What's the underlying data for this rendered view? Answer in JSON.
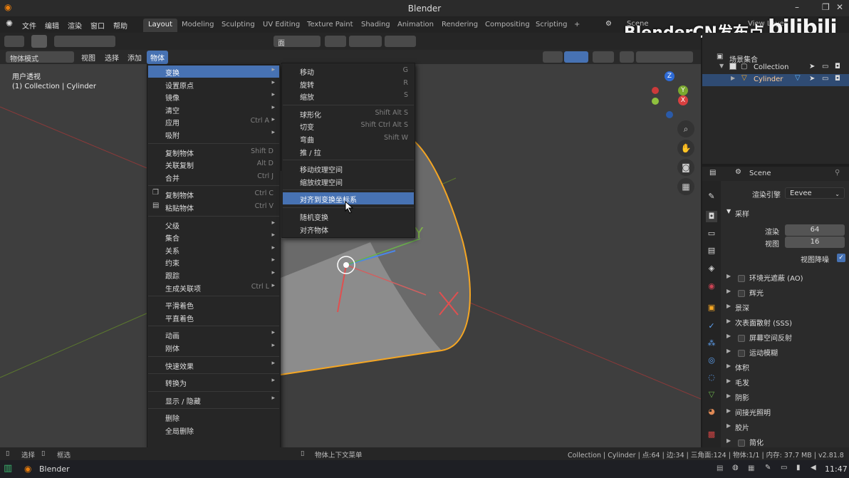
{
  "window": {
    "title": "Blender",
    "minimize": "–",
    "restore": "❐",
    "close": "✕"
  },
  "menubar": {
    "items": [
      "文件",
      "编辑",
      "渲染",
      "窗口",
      "帮助"
    ],
    "workspaces": [
      "Layout",
      "Modeling",
      "Sculpting",
      "UV Editing",
      "Texture Paint",
      "Shading",
      "Animation",
      "Rendering",
      "Compositing",
      "Scripting"
    ],
    "add_tab": "+",
    "scene": "Scene",
    "view_layer": "View Layer"
  },
  "watermark": {
    "text": "BlenderCN发布点",
    "logo": "bilibili"
  },
  "toolbar": {
    "orientation": "面"
  },
  "header": {
    "mode": "物体模式",
    "menus": [
      "视图",
      "选择",
      "添加",
      "物体"
    ]
  },
  "viewport": {
    "view_name": "用户透视",
    "collection_info": "(1) Collection | Cylinder",
    "axis_y_label": "Y"
  },
  "gizmo": {
    "z": "Z",
    "y": "Y",
    "x": "X"
  },
  "object_menu": {
    "items": [
      {
        "label": "变换",
        "shortcut": "",
        "submenu": true,
        "highlight": true
      },
      {
        "label": "设置原点",
        "shortcut": "",
        "submenu": true
      },
      {
        "label": "镜像",
        "shortcut": "",
        "submenu": true
      },
      {
        "label": "清空",
        "shortcut": "",
        "submenu": true
      },
      {
        "label": "应用",
        "shortcut": "Ctrl A",
        "submenu": true
      },
      {
        "label": "吸附",
        "shortcut": "",
        "submenu": true
      },
      {
        "sep": true
      },
      {
        "label": "复制物体",
        "shortcut": "Shift D"
      },
      {
        "label": "关联复制",
        "shortcut": "Alt D"
      },
      {
        "label": "合并",
        "shortcut": "Ctrl J"
      },
      {
        "sep": true
      },
      {
        "label": "复制物体",
        "shortcut": "Ctrl C",
        "icon": "copy"
      },
      {
        "label": "粘贴物体",
        "shortcut": "Ctrl V",
        "icon": "paste"
      },
      {
        "sep": true
      },
      {
        "label": "父级",
        "shortcut": "",
        "submenu": true
      },
      {
        "label": "集合",
        "shortcut": "",
        "submenu": true
      },
      {
        "label": "关系",
        "shortcut": "",
        "submenu": true
      },
      {
        "label": "约束",
        "shortcut": "",
        "submenu": true
      },
      {
        "label": "跟踪",
        "shortcut": "",
        "submenu": true
      },
      {
        "label": "生成关联项",
        "shortcut": "Ctrl L",
        "submenu": true
      },
      {
        "sep": true
      },
      {
        "label": "平滑着色",
        "shortcut": ""
      },
      {
        "label": "平直着色",
        "shortcut": ""
      },
      {
        "sep": true
      },
      {
        "label": "动画",
        "shortcut": "",
        "submenu": true
      },
      {
        "label": "刚体",
        "shortcut": "",
        "submenu": true
      },
      {
        "sep": true
      },
      {
        "label": "快速效果",
        "shortcut": "",
        "submenu": true
      },
      {
        "sep": true
      },
      {
        "label": "转换为",
        "shortcut": "",
        "submenu": true
      },
      {
        "sep": true
      },
      {
        "label": "显示 / 隐藏",
        "shortcut": "",
        "submenu": true
      },
      {
        "sep": true
      },
      {
        "label": "删除",
        "shortcut": ""
      },
      {
        "label": "全局删除",
        "shortcut": ""
      }
    ],
    "more": "▼"
  },
  "transform_menu": {
    "items": [
      {
        "label": "移动",
        "shortcut": "G"
      },
      {
        "label": "旋转",
        "shortcut": "R"
      },
      {
        "label": "缩放",
        "shortcut": "S"
      },
      {
        "sep": true
      },
      {
        "label": "球形化",
        "shortcut": "Shift Alt S"
      },
      {
        "label": "切变",
        "shortcut": "Shift Ctrl Alt S"
      },
      {
        "label": "弯曲",
        "shortcut": "Shift W"
      },
      {
        "label": "推 / 拉",
        "shortcut": ""
      },
      {
        "sep": true
      },
      {
        "label": "移动纹理空间",
        "shortcut": ""
      },
      {
        "label": "缩放纹理空间",
        "shortcut": ""
      },
      {
        "sep": true
      },
      {
        "label": "对齐到变换坐标系",
        "shortcut": "",
        "highlight": true
      },
      {
        "sep": true
      },
      {
        "label": "随机变换",
        "shortcut": ""
      },
      {
        "label": "对齐物体",
        "shortcut": ""
      }
    ]
  },
  "outliner": {
    "root": "场景集合",
    "collection": "Collection",
    "object": "Cylinder"
  },
  "properties": {
    "scene": "Scene",
    "render_engine_label": "渲染引擎",
    "render_engine": "Eevee",
    "sampling": "采样",
    "render_label": "渲染",
    "render_samples": "64",
    "viewport_label": "视图",
    "viewport_samples": "16",
    "viewport_denoise": "视图降噪",
    "panels": [
      {
        "label": "环境光遮蔽 (AO)",
        "check": true
      },
      {
        "label": "辉光",
        "check": true
      },
      {
        "label": "景深",
        "check": false
      },
      {
        "label": "次表面散射 (SSS)",
        "check": false
      },
      {
        "label": "屏幕空间反射",
        "check": true
      },
      {
        "label": "运动模糊",
        "check": true
      },
      {
        "label": "体积",
        "check": false
      },
      {
        "label": "毛发",
        "check": false
      },
      {
        "label": "阴影",
        "check": false
      },
      {
        "label": "间接光照明",
        "check": false
      },
      {
        "label": "胶片",
        "check": false
      },
      {
        "label": "简化",
        "check": true
      }
    ]
  },
  "status": {
    "select": "选择",
    "box_select": "框选",
    "context_menu": "物体上下文菜单",
    "stats": "Collection | Cylinder | 点:64 | 边:34 | 三角面:124 | 物体:1/1 | 内存: 37.7 MB | v2.81.8"
  },
  "taskbar": {
    "app": "Blender",
    "time": "11:47"
  },
  "colors": {
    "accent": "#4772b3",
    "selection": "#f5a623"
  }
}
